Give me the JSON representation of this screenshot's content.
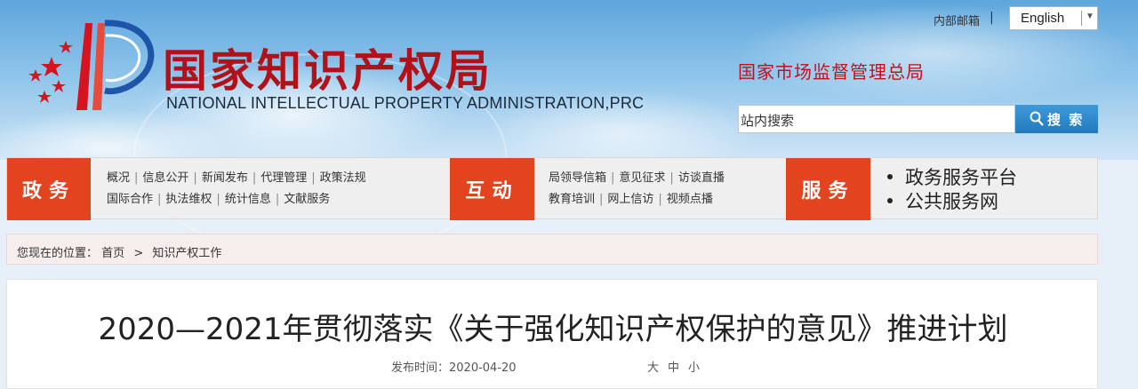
{
  "header": {
    "logo_cn": "国家知识产权局",
    "logo_en": "NATIONAL INTELLECTUAL PROPERTY ADMINISTRATION,PRC",
    "mail_link": "内部邮箱",
    "mail_separator": "|",
    "language_select": {
      "value": "English"
    },
    "parent_agency": "国家市场监督管理总局",
    "search": {
      "placeholder": "站内搜索",
      "button_label": "搜 索"
    },
    "colors": {
      "logo_red": "#b0121a",
      "sky_blue": "#5ea6dc",
      "search_blue": "#2379bf"
    }
  },
  "nav": {
    "accent": "#e24420",
    "sections": [
      {
        "label": "政务",
        "rows": [
          [
            "概况",
            "信息公开",
            "新闻发布",
            "代理管理",
            "政策法规"
          ],
          [
            "国际合作",
            "执法维权",
            "统计信息",
            "文献服务"
          ]
        ]
      },
      {
        "label": "互动",
        "rows": [
          [
            "局领导信箱",
            "意见征求",
            "访谈直播"
          ],
          [
            "教育培训",
            "网上信访",
            "视频点播"
          ]
        ]
      },
      {
        "label": "服务",
        "items": [
          "政务服务平台",
          "公共服务网"
        ]
      }
    ]
  },
  "breadcrumb": {
    "prefix": "您现在的位置：",
    "home": "首页",
    "separator": ">",
    "current": "知识产权工作"
  },
  "article": {
    "title": "2020—2021年贯彻落实《关于强化知识产权保护的意见》推进计划",
    "publish_label": "发布时间：",
    "publish_date": "2020-04-20",
    "font_sizes": [
      "大",
      "中",
      "小"
    ]
  }
}
